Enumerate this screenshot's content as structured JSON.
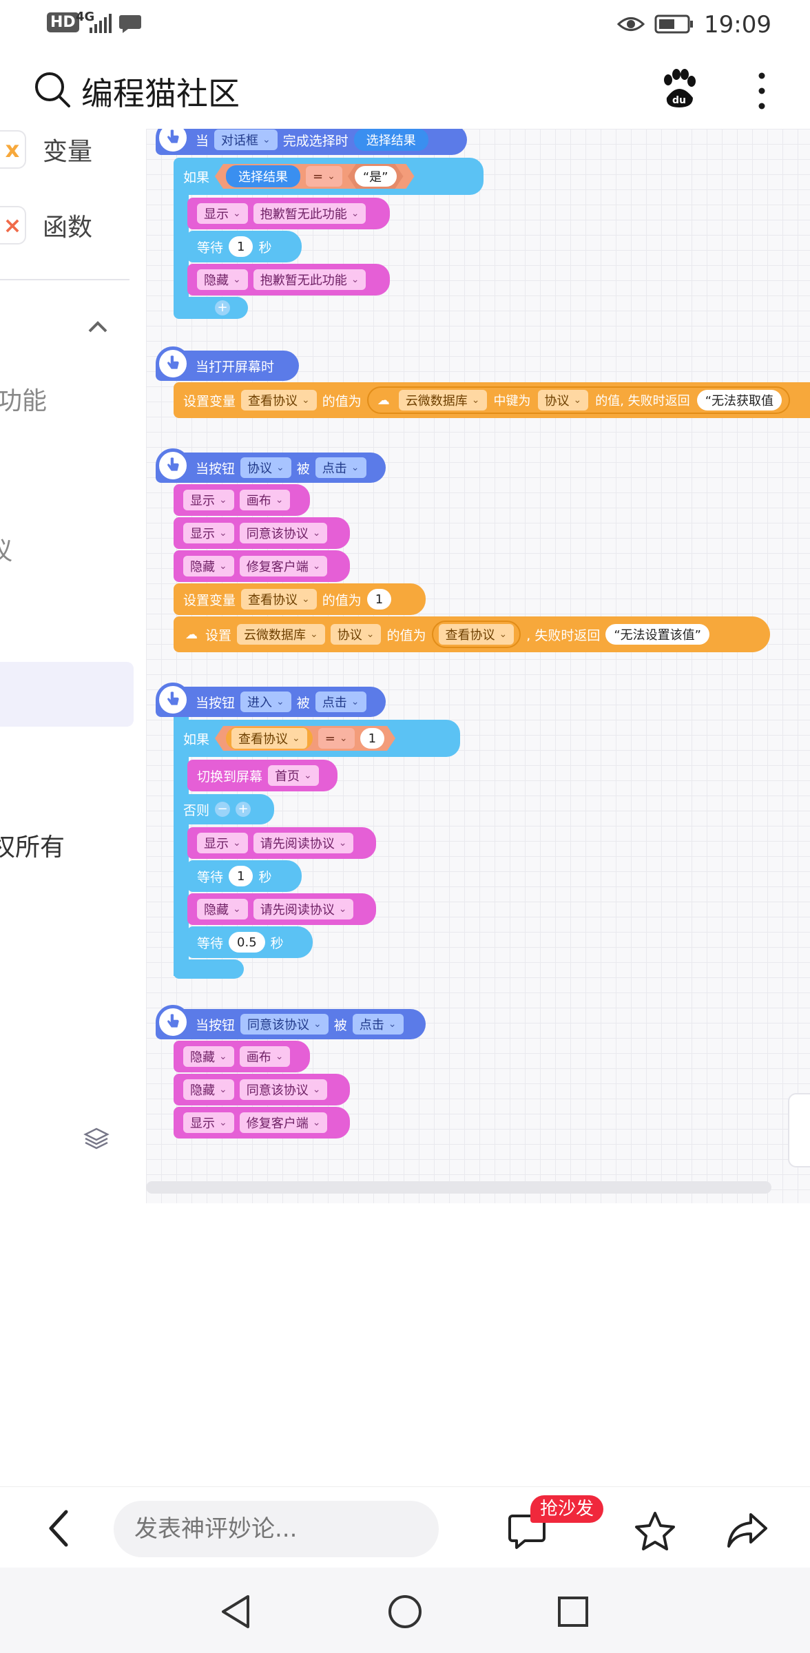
{
  "status": {
    "hd": "HD",
    "net": "4G",
    "time": "19:09"
  },
  "header": {
    "title": "编程猫社区"
  },
  "sidebar": {
    "var_label": "变量",
    "func_label": "函数",
    "cut1": "功能",
    "cut2": "议",
    "cut3": "权所有"
  },
  "blocks": {
    "g1": {
      "when": "当",
      "dialog": "对话框",
      "done": "完成选择时",
      "result": "选择结果",
      "if": "如果",
      "result2": "选择结果",
      "eq": "=",
      "yes": "“是”",
      "show": "显示",
      "sorry": "抱歉暂无此功能",
      "wait": "等待",
      "one": "1",
      "sec": "秒",
      "hide": "隐藏",
      "sorry2": "抱歉暂无此功能"
    },
    "g2": {
      "hat": "当打开屏幕时",
      "setvar": "设置变量",
      "view": "查看协议",
      "valueis": "的值为",
      "clouddb": "云微数据库",
      "keyis": "中键为",
      "proto": "协议",
      "fail": "的值, 失败时返回",
      "failval": "“无法获取值"
    },
    "g3": {
      "hatbtn": "当按钮",
      "btn": "协议",
      "by": "被",
      "click": "点击",
      "show": "显示",
      "canvas": "画布",
      "show2": "显示",
      "agree": "同意该协议",
      "hide": "隐藏",
      "fix": "修复客户端",
      "setvar": "设置变量",
      "view": "查看协议",
      "valueis": "的值为",
      "one": "1",
      "set": "设置",
      "clouddb": "云微数据库",
      "proto": "协议",
      "valueis2": "的值为",
      "view2": "查看协议",
      "failret": ", 失败时返回",
      "failval": "“无法设置该值”"
    },
    "g4": {
      "hatbtn": "当按钮",
      "btn": "进入",
      "by": "被",
      "click": "点击",
      "if": "如果",
      "view": "查看协议",
      "eq": "=",
      "one": "1",
      "switch": "切换到屏幕",
      "home": "首页",
      "else": "否则",
      "show": "显示",
      "read": "请先阅读协议",
      "wait": "等待",
      "one2": "1",
      "sec": "秒",
      "hide": "隐藏",
      "read2": "请先阅读协议",
      "wait2": "等待",
      "half": "0.5",
      "sec2": "秒"
    },
    "g5": {
      "hatbtn": "当按钮",
      "btn": "同意该协议",
      "by": "被",
      "click": "点击",
      "hide": "隐藏",
      "canvas": "画布",
      "hide2": "隐藏",
      "agree": "同意该协议",
      "show": "显示",
      "fix": "修复客户端"
    }
  },
  "bottom": {
    "placeholder": "发表神评妙论...",
    "badge": "抢沙发"
  },
  "colors": {
    "hat": "#5b7be8",
    "control": "#5bc2f4",
    "looks": "#e55fd6",
    "variable": "#f7a83b"
  }
}
